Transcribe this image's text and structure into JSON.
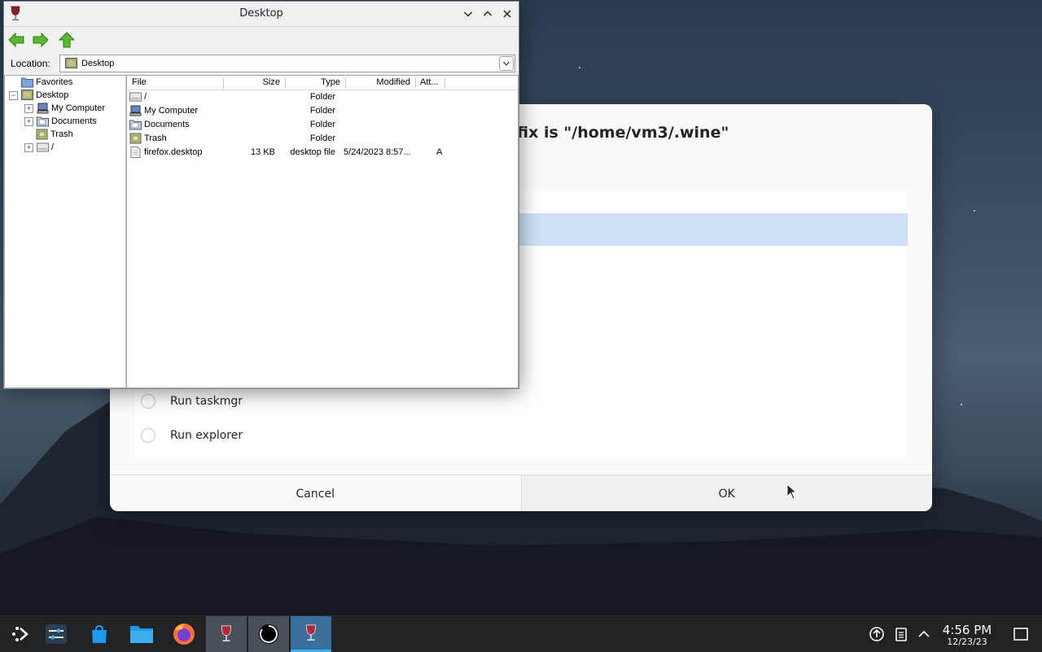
{
  "background_dialog": {
    "heading": "fix is \"/home/vm3/.wine\"",
    "options": [
      "Run taskmgr",
      "Run explorer"
    ],
    "cancel_label": "Cancel",
    "ok_label": "OK"
  },
  "explorer": {
    "title": "Desktop",
    "location_label": "Location:",
    "location_value": "Desktop",
    "tree": [
      {
        "label": "Favorites"
      },
      {
        "label": "Desktop",
        "expander": "−"
      },
      {
        "label": "My Computer",
        "expander": "+"
      },
      {
        "label": "Documents",
        "expander": "+"
      },
      {
        "label": "Trash"
      },
      {
        "label": "/",
        "expander": "+"
      }
    ],
    "columns": [
      "File",
      "Size",
      "Type",
      "Modified",
      "Att..."
    ],
    "files": [
      {
        "name": "/",
        "size": "",
        "type": "Folder",
        "modified": "",
        "attr": ""
      },
      {
        "name": "My Computer",
        "size": "",
        "type": "Folder",
        "modified": "",
        "attr": ""
      },
      {
        "name": "Documents",
        "size": "",
        "type": "Folder",
        "modified": "",
        "attr": ""
      },
      {
        "name": "Trash",
        "size": "",
        "type": "Folder",
        "modified": "",
        "attr": ""
      },
      {
        "name": "firefox.desktop",
        "size": "13 KB",
        "type": "desktop file",
        "modified": "5/24/2023 8:57...",
        "attr": "A"
      }
    ]
  },
  "taskbar": {
    "time": "4:56 PM",
    "date": "12/23/23"
  },
  "colors": {
    "accent": "#3daee9",
    "selection": "#cde0f5",
    "taskbar": "#1f2326"
  }
}
